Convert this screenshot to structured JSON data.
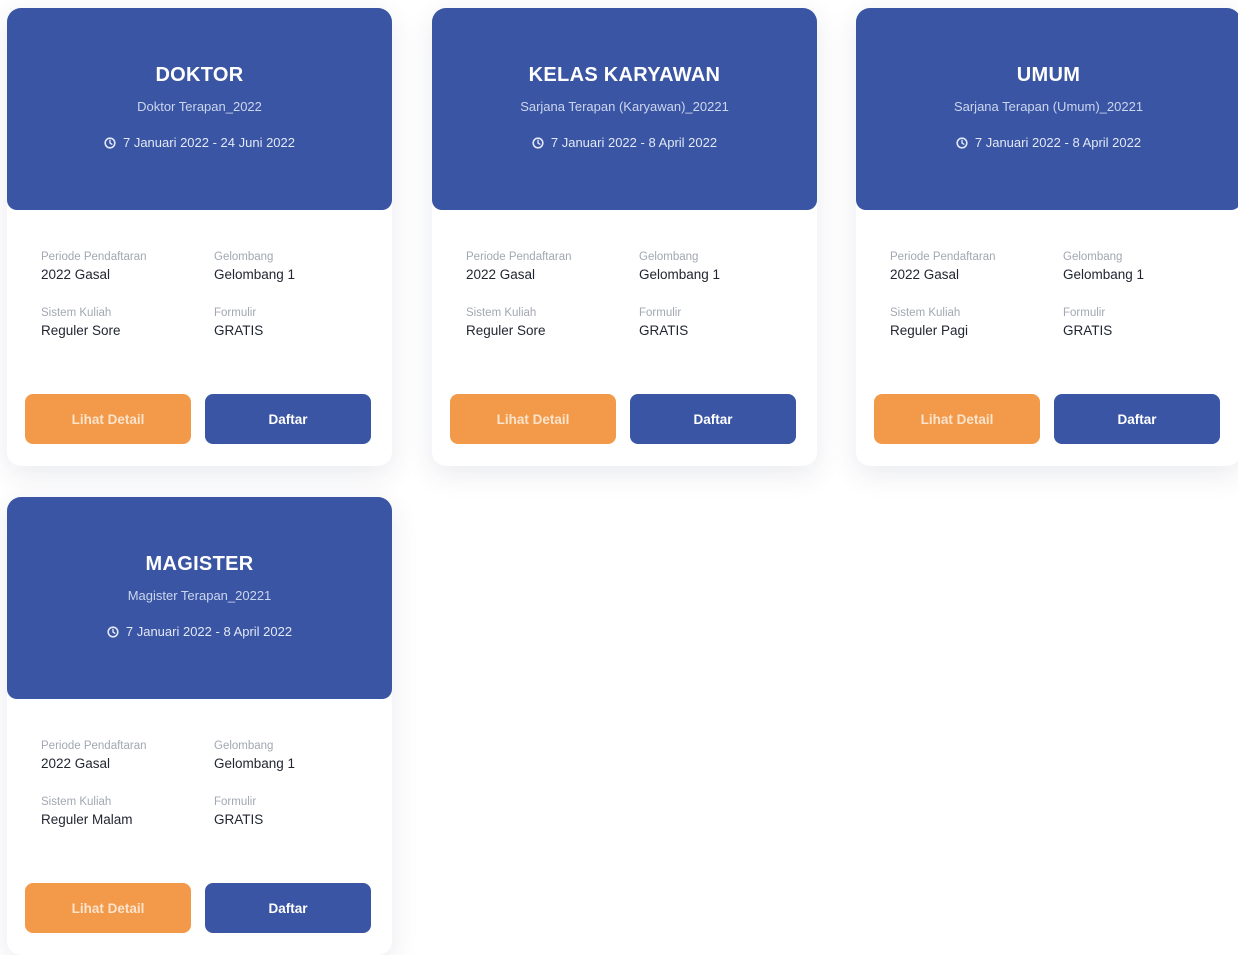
{
  "colors": {
    "header_blue": "#3955a3",
    "detail_orange": "#f29a4a",
    "daftar_blue": "#3955a3"
  },
  "labels": {
    "periode": "Periode Pendaftaran",
    "gelombang": "Gelombang",
    "sistem": "Sistem Kuliah",
    "formulir": "Formulir",
    "detail_button": "Lihat Detail",
    "daftar_button": "Daftar"
  },
  "icons": {
    "date": "clock-icon"
  },
  "cards": [
    {
      "title": "DOKTOR",
      "subtitle": "Doktor Terapan_2022",
      "date_range": "7 Januari 2022 - 24 Juni 2022",
      "periode": "2022 Gasal",
      "gelombang": "Gelombang 1",
      "sistem": "Reguler Sore",
      "formulir": "GRATIS"
    },
    {
      "title": "KELAS KARYAWAN",
      "subtitle": "Sarjana Terapan (Karyawan)_20221",
      "date_range": "7 Januari 2022 - 8 April 2022",
      "periode": "2022 Gasal",
      "gelombang": "Gelombang 1",
      "sistem": "Reguler Sore",
      "formulir": "GRATIS"
    },
    {
      "title": "UMUM",
      "subtitle": "Sarjana Terapan (Umum)_20221",
      "date_range": "7 Januari 2022 - 8 April 2022",
      "periode": "2022 Gasal",
      "gelombang": "Gelombang 1",
      "sistem": "Reguler Pagi",
      "formulir": "GRATIS"
    },
    {
      "title": "MAGISTER",
      "subtitle": "Magister Terapan_20221",
      "date_range": "7 Januari 2022 - 8 April 2022",
      "periode": "2022 Gasal",
      "gelombang": "Gelombang 1",
      "sistem": "Reguler Malam",
      "formulir": "GRATIS"
    }
  ]
}
